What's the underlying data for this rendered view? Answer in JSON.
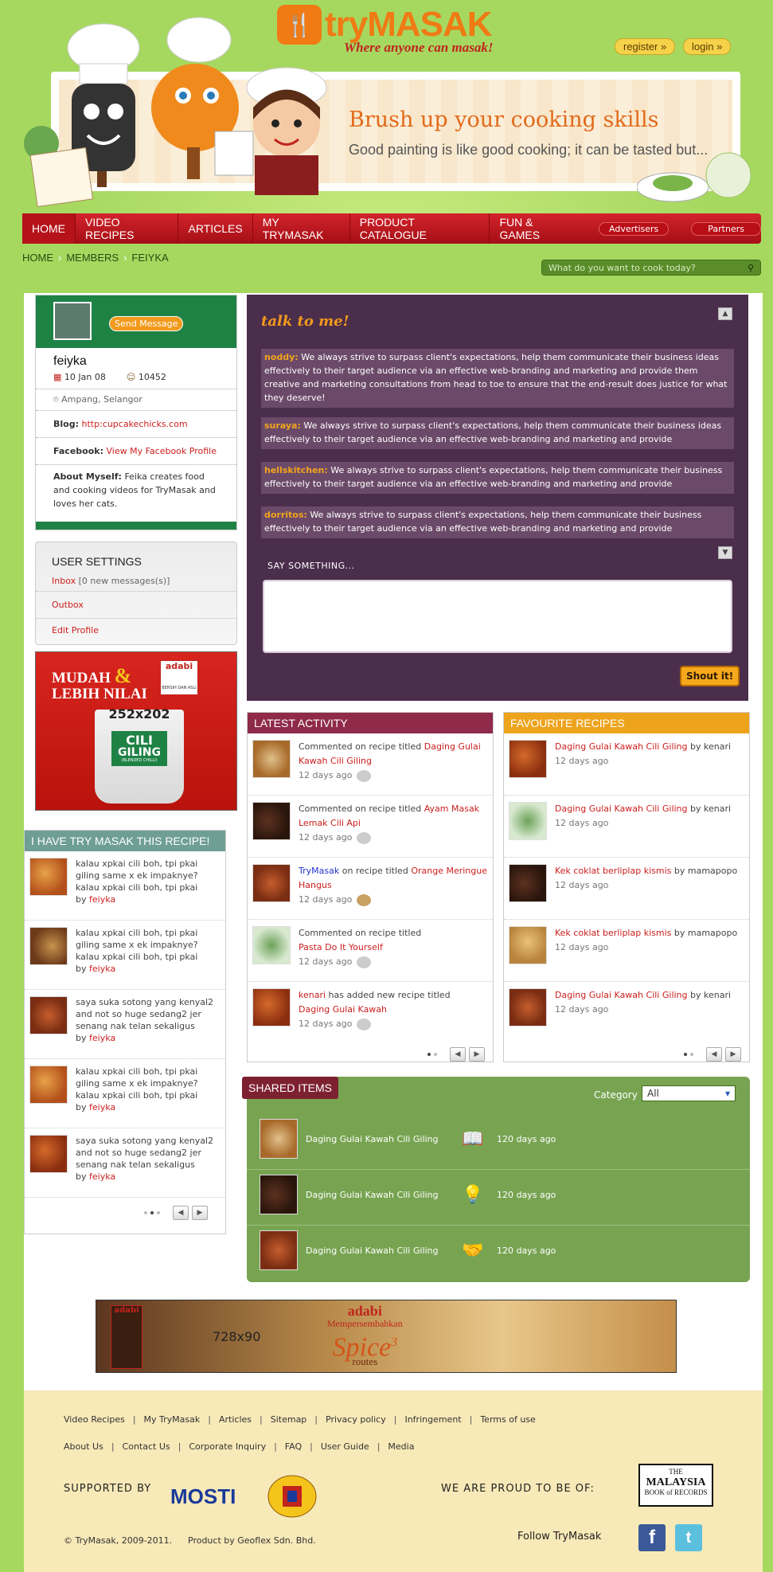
{
  "header": {
    "logo_text": "tryMASAK",
    "tagline": "Where anyone can masak!",
    "register_label": "register",
    "login_label": "login"
  },
  "banner": {
    "title": "Brush up your cooking skills",
    "subtitle": "Good painting is like good cooking; it can be tasted but..."
  },
  "nav": {
    "items": [
      "HOME",
      "VIDEO RECIPES",
      "ARTICLES",
      "MY TRYMASAK",
      "PRODUCT CATALOGUE",
      "FUN & GAMES"
    ],
    "advertisers": "Advertisers",
    "partners": "Partners"
  },
  "breadcrumb": [
    "HOME",
    "MEMBERS",
    "FEIYKA"
  ],
  "search": {
    "placeholder": "What do you want to cook today?"
  },
  "profile": {
    "send_message": "Send Message",
    "name": "feiyka",
    "joined": "10 Jan 08",
    "points": "10452",
    "location": "Ampang, Selangor",
    "blog_label": "Blog:",
    "blog_value": "http:cupcakechicks.com",
    "facebook_label": "Facebook:",
    "facebook_value": "View My Facebook Profile",
    "about_label": "About Myself:",
    "about_value": "Feika creates food and cooking videos for TryMasak and loves her cats."
  },
  "settings": {
    "title": "USER SETTINGS",
    "inbox": "Inbox",
    "inbox_count": "[0 new messages(s)]",
    "outbox": "Outbox",
    "edit": "Edit Profile"
  },
  "ad1": {
    "headline1": "MUDAH",
    "amp": "&",
    "headline2": "LEBIH NILAI",
    "brand": "adabi",
    "brand_sub": "BERSIH DAN ASLI",
    "size": "252x202",
    "product1": "CILI",
    "product2": "GILING",
    "product3": "(BLENDED CHILLI)"
  },
  "tried": {
    "title": "I HAVE TRY MASAK THIS RECIPE!",
    "by": "by",
    "items": [
      {
        "text": "kalau xpkai cili boh, tpi pkai giling same x ek impaknye? kalau xpkai cili boh, tpi pkai",
        "user": "feiyka"
      },
      {
        "text": "kalau xpkai cili boh, tpi pkai giling same x ek impaknye? kalau xpkai cili boh, tpi pkai",
        "user": "feiyka"
      },
      {
        "text": "saya suka sotong yang kenyal2 and not so huge sedang2 jer senang nak telan sekaligus",
        "user": "feiyka"
      },
      {
        "text": "kalau xpkai cili boh, tpi pkai giling same x ek impaknye? kalau xpkai cili boh, tpi pkai",
        "user": "feiyka"
      },
      {
        "text": "saya suka sotong yang kenyal2 and not so huge sedang2 jer senang nak telan sekaligus",
        "user": "feiyka"
      }
    ]
  },
  "talk": {
    "title": "talk to me!",
    "messages": [
      {
        "user": "noddy:",
        "text": "We always strive to surpass client's expectations, help them communicate their business ideas effectively to their target audience via an effective web-branding and marketing and provide them creative and marketing consultations from head to toe to ensure that the end-result does justice for what they deserve!"
      },
      {
        "user": "suraya:",
        "text": "We always strive to surpass client's expectations, help them communicate their business ideas effectively to their target audience via an effective web-branding and marketing and provide"
      },
      {
        "user": "hellskitchen:",
        "text": "We always strive to surpass client's expectations, help them communicate their business effectively to their target audience via an effective web-branding and marketing and provide"
      },
      {
        "user": "dorritos:",
        "text": "We always strive to surpass client's expectations, help them communicate their business effectively to their target audience via an effective web-branding and marketing and provide"
      }
    ],
    "say_label": "SAY SOMETHING...",
    "shout_label": "Shout it!"
  },
  "activity": {
    "title": "LATEST ACTIVITY",
    "items": [
      {
        "actor": "",
        "action": "Commented on recipe titled",
        "recipe": "Daging Gulai Kawah Cili Giling",
        "ago": "12 days ago"
      },
      {
        "actor": "",
        "action": "Commented on recipe titled",
        "recipe": "Ayam Masak Lemak Cili Api",
        "ago": "12 days ago"
      },
      {
        "actor": "TryMasak",
        "action": "on recipe titled",
        "recipe": "Orange Meringue Hangus",
        "ago": "12 days ago"
      },
      {
        "actor": "",
        "action": "Commented on recipe titled",
        "recipe": "Pasta Do It Yourself",
        "ago": "12 days ago"
      },
      {
        "actor": "kenari",
        "action": "has added new recipe titled",
        "recipe": "Daging Gulai Kawah",
        "ago": "12 days ago"
      }
    ]
  },
  "favourites": {
    "title": "FAVOURITE RECIPES",
    "by": "by",
    "items": [
      {
        "recipe": "Daging Gulai Kawah Cili Giling",
        "user": "kenari",
        "ago": "12 days ago"
      },
      {
        "recipe": "Daging Gulai Kawah Cili Giling",
        "user": "kenari",
        "ago": "12 days ago"
      },
      {
        "recipe": "Kek coklat berliplap kismis",
        "user": "mamapopo",
        "ago": "12 days ago"
      },
      {
        "recipe": "Kek coklat berliplap kismis",
        "user": "mamapopo",
        "ago": "12 days ago"
      },
      {
        "recipe": "Daging Gulai Kawah Cili Giling",
        "user": "kenari",
        "ago": "12 days ago"
      }
    ]
  },
  "shared": {
    "title": "SHARED ITEMS",
    "category_label": "Category",
    "category_value": "All",
    "items": [
      {
        "name": "Daging Gulai Kawah Cili Giling",
        "ago": "120 days ago",
        "icon": "book-icon"
      },
      {
        "name": "Daging Gulai Kawah Cili Giling",
        "ago": "120 days ago",
        "icon": "lightbulb-icon"
      },
      {
        "name": "Daging Gulai Kawah Cili Giling",
        "ago": "120 days ago",
        "icon": "handshake-icon"
      }
    ]
  },
  "ad2": {
    "size": "728x90",
    "brand": "adabi",
    "line1": "Mempersembahkan",
    "line2": "Spice",
    "num": "3",
    "line3": "routes"
  },
  "footer": {
    "links1": [
      "Video Recipes",
      "My TryMasak",
      "Articles",
      "Sitemap",
      "Privacy policy",
      "Infringement",
      "Terms of use"
    ],
    "links2": [
      "About Us",
      "Contact Us",
      "Corporate Inquiry",
      "FAQ",
      "User Guide",
      "Media"
    ],
    "supported_by": "SUPPORTED BY",
    "mosti": "MOSTI",
    "proud": "WE ARE PROUD TO BE OF:",
    "records1": "THE",
    "records2": "MALAYSIA",
    "records3": "BOOK of RECORDS",
    "copyright": "© TryMasak, 2009-2011.",
    "product_by": "Product by Geoflex Sdn. Bhd.",
    "follow": "Follow TryMasak"
  },
  "colors": {
    "page_bg": "#a6d860",
    "nav_red": "#c0151d",
    "talk_bg": "#4b2e4b",
    "activity_head": "#8f2a4a",
    "fav_head": "#eda31c",
    "shared_bg": "#78a452",
    "footer_bg": "#f8e9b8"
  }
}
